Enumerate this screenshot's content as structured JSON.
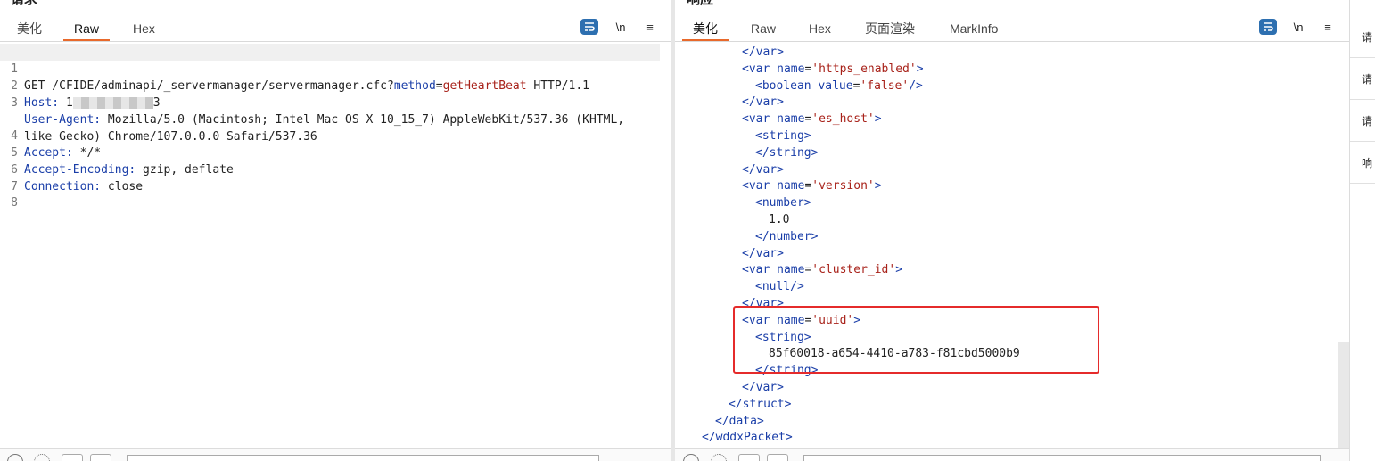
{
  "request": {
    "title": "请求",
    "tabs": [
      "美化",
      "Raw",
      "Hex"
    ],
    "active_tab": "Raw",
    "tools": {
      "wrap_icon": "wrap-icon",
      "newline_label": "\\n",
      "menu_label": "≡"
    },
    "lines": [
      {
        "n": "1",
        "method": "GET",
        "path": " /CFIDE/adminapi/_servermanager/servermanager.cfc?",
        "param": "method",
        "eq": "=",
        "pval": "getHeartBeat",
        "proto": " HTTP/1.1"
      },
      {
        "n": "2",
        "key": "Host:",
        "val_pre": " 1",
        "val_post": "3"
      },
      {
        "n": "3",
        "key": "User-Agent:",
        "val": " Mozilla/5.0 (Macintosh; Intel Mac OS X 10_15_7) AppleWebKit/537.36 (KHTML,"
      },
      {
        "n": "",
        "val": "like Gecko) Chrome/107.0.0.0 Safari/537.36"
      },
      {
        "n": "4",
        "key": "Accept:",
        "val": " */*"
      },
      {
        "n": "5",
        "key": "Accept-Encoding:",
        "val": " gzip, deflate"
      },
      {
        "n": "6",
        "key": "Connection:",
        "val": " close"
      },
      {
        "n": "7"
      },
      {
        "n": "8"
      }
    ]
  },
  "response": {
    "title": "响应",
    "tabs": [
      "美化",
      "Raw",
      "Hex",
      "页面渲染",
      "MarkInfo"
    ],
    "active_tab": "美化",
    "tools": {
      "wrap_icon": "wrap-icon",
      "newline_label": "\\n",
      "menu_label": "≡"
    },
    "lines": [
      "</var>",
      "<var name='https_enabled'>",
      "<boolean value='false'/>",
      "</var>",
      "<var name='es_host'>",
      "<string>",
      "</string>",
      "</var>",
      "<var name='version'>",
      "<number>",
      "1.0",
      "</number>",
      "</var>",
      "<var name='cluster_id'>",
      "<null/>",
      "</var>",
      "<var name='uuid'>",
      "<string>",
      "85f60018-a654-4410-a783-f81cbd5000b9",
      "</string>",
      "</var>",
      "</struct>",
      "</data>",
      "</wddxPacket>"
    ]
  },
  "side": {
    "items": [
      "请",
      "请",
      "请",
      "响"
    ]
  },
  "colors": {
    "accent": "#e8692b",
    "highlight_box": "#e52b2b",
    "tag": "#1a3ea8",
    "string": "#a8221a"
  }
}
